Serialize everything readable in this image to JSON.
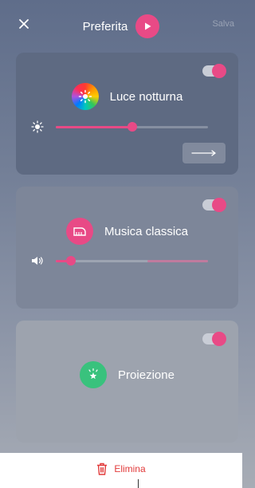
{
  "header": {
    "title": "Preferita",
    "save_label": "Salva"
  },
  "cards": [
    {
      "title": "Luce notturna",
      "enabled": true,
      "slider_level": 0.5,
      "icon": "night-light-icon",
      "slider_icon": "brightness-icon",
      "action_icon": "arrow-right-icon"
    },
    {
      "title": "Musica classica",
      "enabled": true,
      "slider_level": 0.1,
      "icon": "piano-icon",
      "slider_icon": "volume-icon"
    },
    {
      "title": "Proiezione",
      "enabled": true,
      "icon": "projection-star-icon"
    }
  ],
  "footer": {
    "delete_label": "Elimina"
  },
  "colors": {
    "accent": "#e84a86",
    "delete": "#e23b3b",
    "projection_green": "#39c27d"
  }
}
